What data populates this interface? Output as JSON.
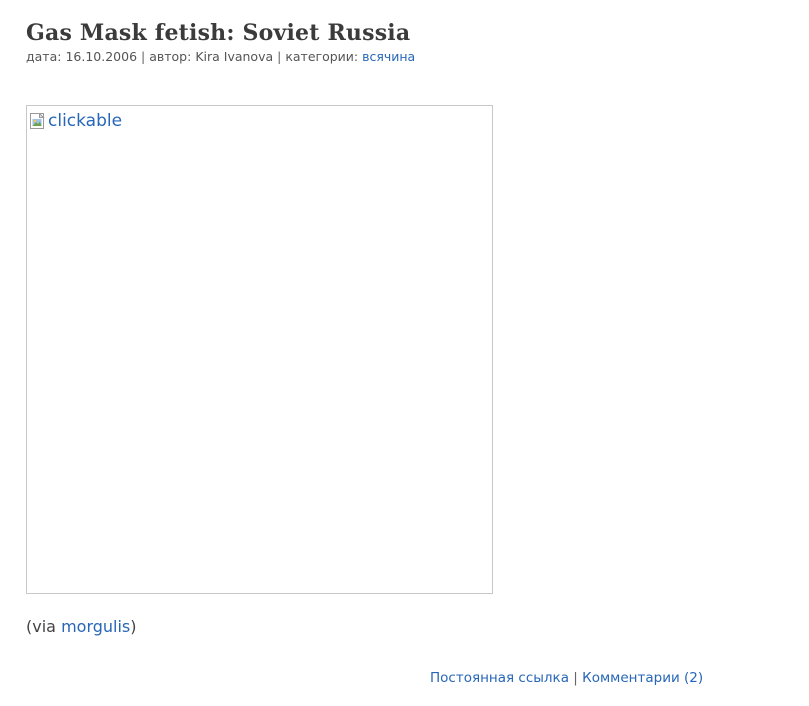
{
  "post": {
    "title": "Gas Mask fetish: Soviet Russia",
    "meta": {
      "date_label": "дата:",
      "date_value": "16.10.2006",
      "separator": "|",
      "author_label": "автор:",
      "author_value": "Kira Ivanova",
      "categories_label": "категории:",
      "category_link": "всячина"
    },
    "image": {
      "alt_text": "clickable",
      "icon": "broken-image-icon"
    },
    "via": {
      "prefix": "(via",
      "link_text": "morgulis",
      "suffix": ")"
    },
    "footer": {
      "permalink_label": "Постоянная ссылка",
      "separator": "|",
      "comments_label": "Комментарии (2)"
    }
  },
  "colors": {
    "link": "#2766b8",
    "title": "#3b3b3b",
    "meta_text": "#555555",
    "frame_border": "#c8c8c8",
    "background": "#ffffff"
  }
}
